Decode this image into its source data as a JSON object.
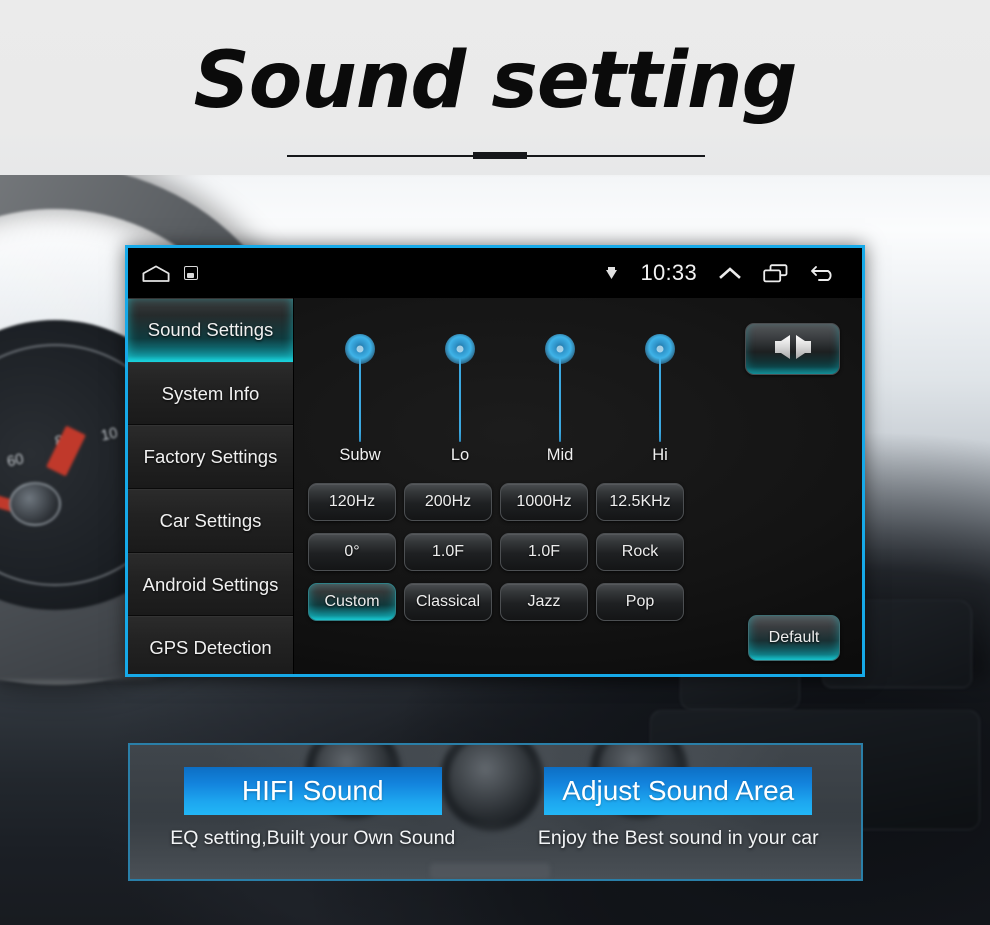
{
  "page": {
    "title": "Sound setting"
  },
  "statusbar": {
    "home_icon": "home-icon",
    "app_icon": "app-square-icon",
    "signal_icon": "signal-icon",
    "time": "10:33",
    "expand_icon": "chevron-up-icon",
    "recents_icon": "recents-icon",
    "back_icon": "back-arrow-icon"
  },
  "sidebar": {
    "items": [
      {
        "label": "Sound Settings",
        "selected": true
      },
      {
        "label": "System Info",
        "selected": false
      },
      {
        "label": "Factory Settings",
        "selected": false
      },
      {
        "label": "Car Settings",
        "selected": false
      },
      {
        "label": "Android Settings",
        "selected": false
      },
      {
        "label": "GPS Detection",
        "selected": false
      }
    ]
  },
  "main": {
    "balance_button": {
      "icon": "speaker-balance-icon",
      "label": ""
    },
    "sliders": [
      {
        "label": "Subw",
        "value": 100
      },
      {
        "label": "Lo",
        "value": 100
      },
      {
        "label": "Mid",
        "value": 100
      },
      {
        "label": "Hi",
        "value": 100
      }
    ],
    "buttons": [
      {
        "label": "120Hz",
        "selected": false
      },
      {
        "label": "200Hz",
        "selected": false
      },
      {
        "label": "1000Hz",
        "selected": false
      },
      {
        "label": "12.5KHz",
        "selected": false
      },
      {
        "label": "0°",
        "selected": false
      },
      {
        "label": "1.0F",
        "selected": false
      },
      {
        "label": "1.0F",
        "selected": false
      },
      {
        "label": "Rock",
        "selected": false
      },
      {
        "label": "Custom",
        "selected": true
      },
      {
        "label": "Classical",
        "selected": false
      },
      {
        "label": "Jazz",
        "selected": false
      },
      {
        "label": "Pop",
        "selected": false
      }
    ],
    "default_button": "Default"
  },
  "banner": {
    "features": [
      {
        "button": "HIFI Sound",
        "caption": "EQ setting,Built your Own Sound"
      },
      {
        "button": "Adjust Sound Area",
        "caption": "Enjoy the Best sound in your car"
      }
    ]
  },
  "colors": {
    "accent_cyan": "#16a9e8",
    "accent_teal": "#17c6cf",
    "slider_blue": "#3fb3e8",
    "banner_blue": "#1da6ef",
    "banner_border": "#2a7fa8",
    "page_bg": "#eaeaea",
    "screen_bg": "#141414"
  }
}
